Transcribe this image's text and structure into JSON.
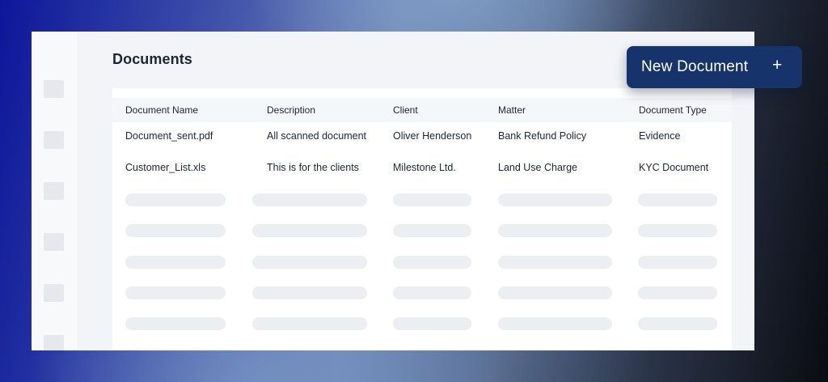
{
  "page": {
    "title": "Documents"
  },
  "actions": {
    "new_document_label": "New Document",
    "new_document_icon": "plus-icon"
  },
  "table": {
    "columns": [
      "Document Name",
      "Description",
      "Client",
      "Matter",
      "Document Type"
    ],
    "rows": [
      [
        "Document_sent.pdf",
        "All scanned document",
        "Oliver Henderson",
        "Bank Refund Policy",
        "Evidence"
      ],
      [
        "Customer_List.xls",
        "This is for the clients",
        "Milestone Ltd.",
        "Land Use Charge",
        "KYC Document"
      ]
    ],
    "placeholder_rows": 5
  },
  "sidebar": {
    "icons": [
      "nav-icon",
      "nav-icon",
      "nav-icon",
      "nav-icon",
      "nav-icon",
      "nav-icon"
    ]
  },
  "colors": {
    "button_bg": "#16336b",
    "button_text": "#ffffff",
    "title_text": "#1c2537",
    "skeleton": "#eceef2"
  }
}
